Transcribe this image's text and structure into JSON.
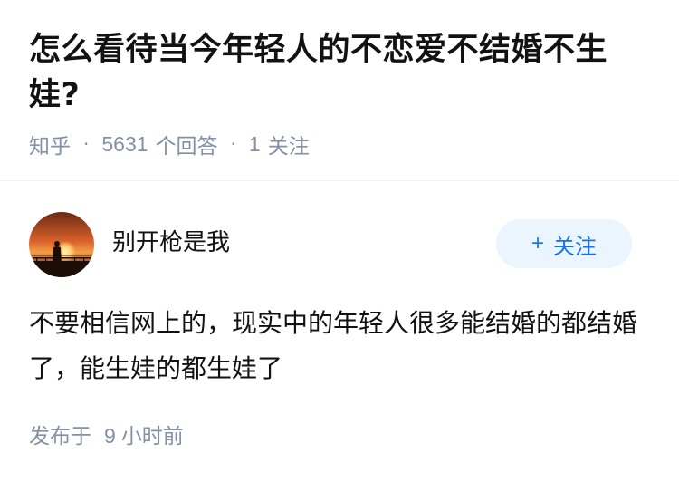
{
  "question": {
    "title": "怎么看待当今年轻人的不恋爱不结婚不生娃?",
    "source": "知乎",
    "separator": "·",
    "answer_count": "5631",
    "answer_count_label": "个回答",
    "follower_count": "1",
    "follower_label": "关注"
  },
  "answer": {
    "author": {
      "name": "别开枪是我",
      "avatar_icon": "sunset-avatar-icon"
    },
    "follow_button": {
      "icon": "plus-icon",
      "plus": "+",
      "label": "关注"
    },
    "content": "不要相信网上的，现实中的年轻人很多能结婚的都结婚了，能生娃的都生娃了",
    "published_prefix": "发布于",
    "published_value": "9",
    "published_unit": "小时前"
  },
  "colors": {
    "text_primary": "#121212",
    "text_secondary": "#8590a6",
    "accent": "#1772f6",
    "follow_bg": "#ebf5fd"
  }
}
